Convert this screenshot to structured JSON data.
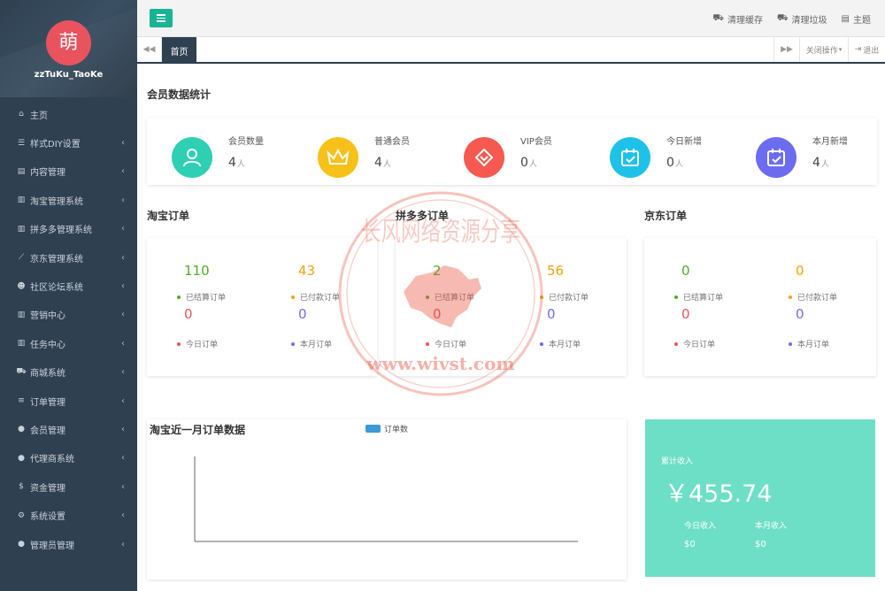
{
  "sidebar": {
    "avatar_char": "萌",
    "username": "zzTuKu_TaoKe",
    "items": [
      {
        "icon": "home-icon",
        "glyph": "⌂",
        "label": "主页",
        "chevron": false
      },
      {
        "icon": "list-icon",
        "glyph": "☰",
        "label": "样式DIY设置",
        "chevron": true
      },
      {
        "icon": "content-icon",
        "glyph": "▤",
        "label": "内容管理",
        "chevron": true
      },
      {
        "icon": "bar-chart-icon",
        "glyph": "▥",
        "label": "淘宝管理系统",
        "chevron": true
      },
      {
        "icon": "bar-chart-icon",
        "glyph": "▥",
        "label": "拼多多管理系统",
        "chevron": true
      },
      {
        "icon": "line-chart-icon",
        "glyph": "⟋",
        "label": "京东管理系统",
        "chevron": true
      },
      {
        "icon": "users-icon",
        "glyph": "☻",
        "label": "社区论坛系统",
        "chevron": true
      },
      {
        "icon": "bar-chart-icon",
        "glyph": "▥",
        "label": "营销中心",
        "chevron": true
      },
      {
        "icon": "bar-chart-icon",
        "glyph": "▥",
        "label": "任务中心",
        "chevron": true
      },
      {
        "icon": "cart-icon",
        "glyph": "⛟",
        "label": "商城系统",
        "chevron": true
      },
      {
        "icon": "list-icon",
        "glyph": "≡",
        "label": "订单管理",
        "chevron": true
      },
      {
        "icon": "user-icon",
        "glyph": "●",
        "label": "会员管理",
        "chevron": true
      },
      {
        "icon": "user-icon",
        "glyph": "●",
        "label": "代理商系统",
        "chevron": true
      },
      {
        "icon": "dollar-icon",
        "glyph": "$",
        "label": "资金管理",
        "chevron": true
      },
      {
        "icon": "gear-icon",
        "glyph": "⚙",
        "label": "系统设置",
        "chevron": true
      },
      {
        "icon": "user-plus-icon",
        "glyph": "●",
        "label": "管理员管理",
        "chevron": true
      }
    ]
  },
  "topbar": {
    "clear_cache": "清理缓存",
    "clear_trash": "清理垃圾",
    "theme": "主题"
  },
  "tabs": {
    "home": "首页",
    "close_ops": "关闭操作",
    "logout": "退出"
  },
  "member_stats": {
    "title": "会员数据统计",
    "items": [
      {
        "label": "会员数量",
        "value": "4",
        "unit": "人",
        "color": "#2ecfb3",
        "icon": "user-icon"
      },
      {
        "label": "普通会员",
        "value": "4",
        "unit": "人",
        "color": "#f7c11a",
        "icon": "crown-icon"
      },
      {
        "label": "VIP会员",
        "value": "0",
        "unit": "人",
        "color": "#f5594f",
        "icon": "diamond-icon"
      },
      {
        "label": "今日新增",
        "value": "0",
        "unit": "人",
        "color": "#1ec2e8",
        "icon": "calendar-check-icon"
      },
      {
        "label": "本月新增",
        "value": "4",
        "unit": "人",
        "color": "#6c6cf0",
        "icon": "calendar-check-icon"
      }
    ]
  },
  "orders": [
    {
      "title": "淘宝订单",
      "settled": "110",
      "settled_label": "已结算订单",
      "paid": "43",
      "paid_label": "已付款订单",
      "today": "0",
      "today_label": "今日订单",
      "month": "0",
      "month_label": "本月订单"
    },
    {
      "title": "拼多多订单",
      "settled": "2",
      "settled_label": "已结算订单",
      "paid": "56",
      "paid_label": "已付款订单",
      "today": "0",
      "today_label": "今日订单",
      "month": "0",
      "month_label": "本月订单"
    },
    {
      "title": "京东订单",
      "settled": "0",
      "settled_label": "已结算订单",
      "paid": "0",
      "paid_label": "已付款订单",
      "today": "0",
      "today_label": "今日订单",
      "month": "0",
      "month_label": "本月订单"
    }
  ],
  "order_colors": {
    "settled": "#4caf24",
    "paid": "#f0a30a",
    "today": "#e9535e",
    "month": "#6c6cf0"
  },
  "chart_data": {
    "type": "bar",
    "title": "淘宝近一月订单数据",
    "series": [
      {
        "name": "订单数",
        "color": "#3c9ad6",
        "values": []
      }
    ],
    "categories": []
  },
  "income": {
    "total_label": "累计收入",
    "total_value": "￥455.74",
    "today_label": "今日收入",
    "today_value": "$0",
    "month_label": "本月收入",
    "month_value": "$0"
  },
  "watermark": {
    "text_top": "长风网络资源分享",
    "url": "www.wivst.com"
  }
}
